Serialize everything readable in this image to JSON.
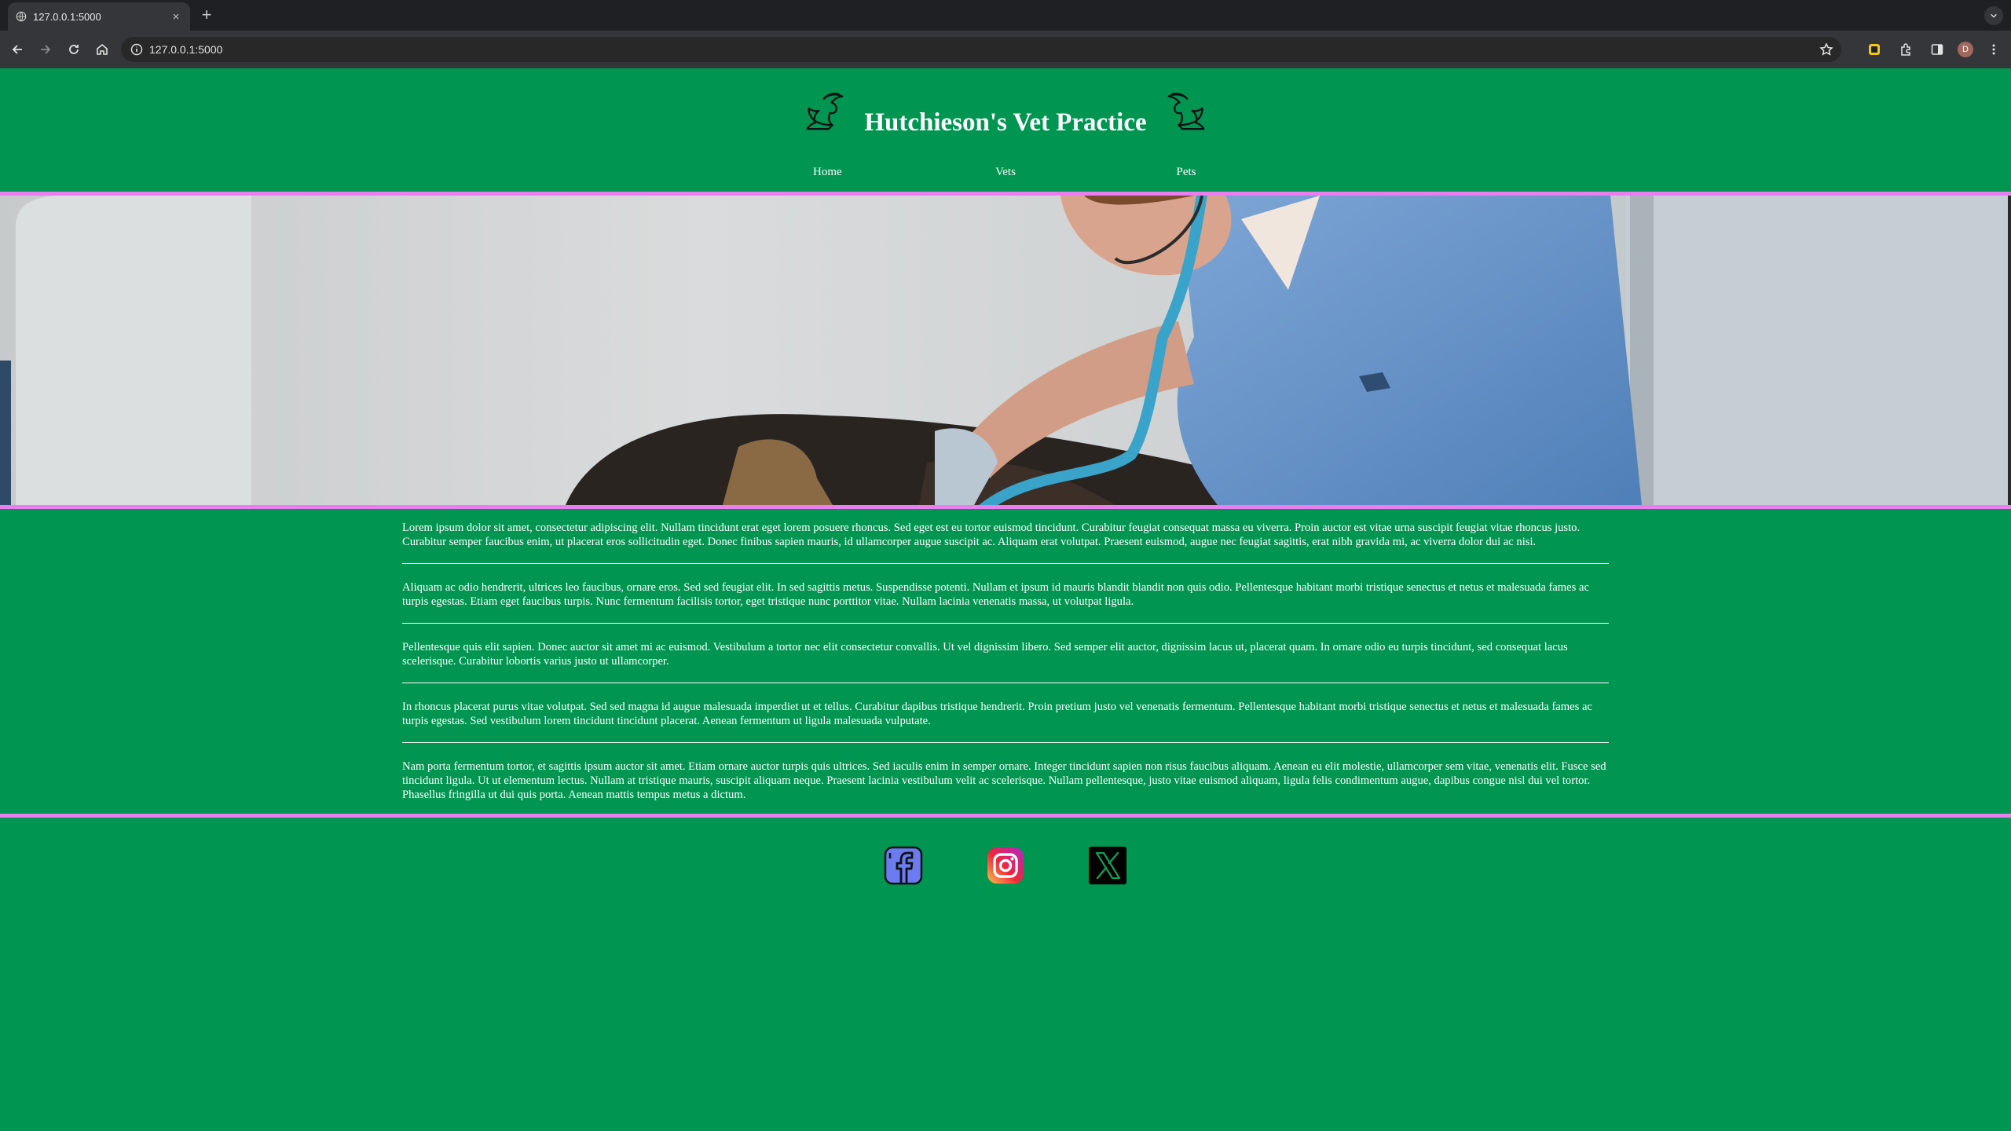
{
  "browser": {
    "tab_title": "127.0.0.1:5000",
    "close_glyph": "×",
    "new_tab_glyph": "+",
    "url": "127.0.0.1:5000",
    "profile_initial": "D"
  },
  "site": {
    "title": "Hutchieson's Vet Practice",
    "nav": [
      "Home",
      "Vets",
      "Pets"
    ],
    "paragraphs": [
      "Lorem ipsum dolor sit amet, consectetur adipiscing elit. Nullam tincidunt erat eget lorem posuere rhoncus. Sed eget est eu tortor euismod tincidunt. Curabitur feugiat consequat massa eu viverra. Proin auctor est vitae urna suscipit feugiat vitae rhoncus justo. Curabitur semper faucibus enim, ut placerat eros sollicitudin eget. Donec finibus sapien mauris, id ullamcorper augue suscipit ac. Aliquam erat volutpat. Praesent euismod, augue nec feugiat sagittis, erat nibh gravida mi, ac viverra dolor dui ac nisi.",
      "Aliquam ac odio hendrerit, ultrices leo faucibus, ornare eros. Sed sed feugiat elit. In sed sagittis metus. Suspendisse potenti. Nullam et ipsum id mauris blandit blandit non quis odio. Pellentesque habitant morbi tristique senectus et netus et malesuada fames ac turpis egestas. Etiam eget faucibus turpis. Nunc fermentum facilisis tortor, eget tristique nunc porttitor vitae. Nullam lacinia venenatis massa, ut volutpat ligula.",
      "Pellentesque quis elit sapien. Donec auctor sit amet mi ac euismod. Vestibulum a tortor nec elit consectetur convallis. Ut vel dignissim libero. Sed semper elit auctor, dignissim lacus ut, placerat quam. In ornare odio eu turpis tincidunt, sed consequat lacus scelerisque. Curabitur lobortis varius justo ut ullamcorper.",
      "In rhoncus placerat purus vitae volutpat. Sed sed magna id augue malesuada imperdiet ut et tellus. Curabitur dapibus tristique hendrerit. Proin pretium justo vel venenatis fermentum. Pellentesque habitant morbi tristique senectus et netus et malesuada fames ac turpis egestas. Sed vestibulum lorem tincidunt tincidunt placerat. Aenean fermentum ut ligula malesuada vulputate.",
      "Nam porta fermentum tortor, et sagittis ipsum auctor sit amet. Etiam ornare auctor turpis quis ultrices. Sed iaculis enim in semper ornare. Integer tincidunt sapien non risus faucibus aliquam. Aenean eu elit molestie, ullamcorper sem vitae, venenatis elit. Fusce sed tincidunt ligula. Ut ut elementum lectus. Nullam at tristique mauris, suscipit aliquam neque. Praesent lacinia vestibulum velit ac scelerisque. Nullam pellentesque, justo vitae euismod aliquam, ligula felis condimentum augue, dapibus congue nisl dui vel tortor. Phasellus fringilla ut dui quis porta. Aenean mattis tempus metus a dictum."
    ],
    "social_icons": [
      "facebook-icon",
      "instagram-icon",
      "x-twitter-icon"
    ]
  },
  "colors": {
    "page_bg": "#009550",
    "accent_rule": "#ea7df0",
    "text": "#ffffff"
  }
}
